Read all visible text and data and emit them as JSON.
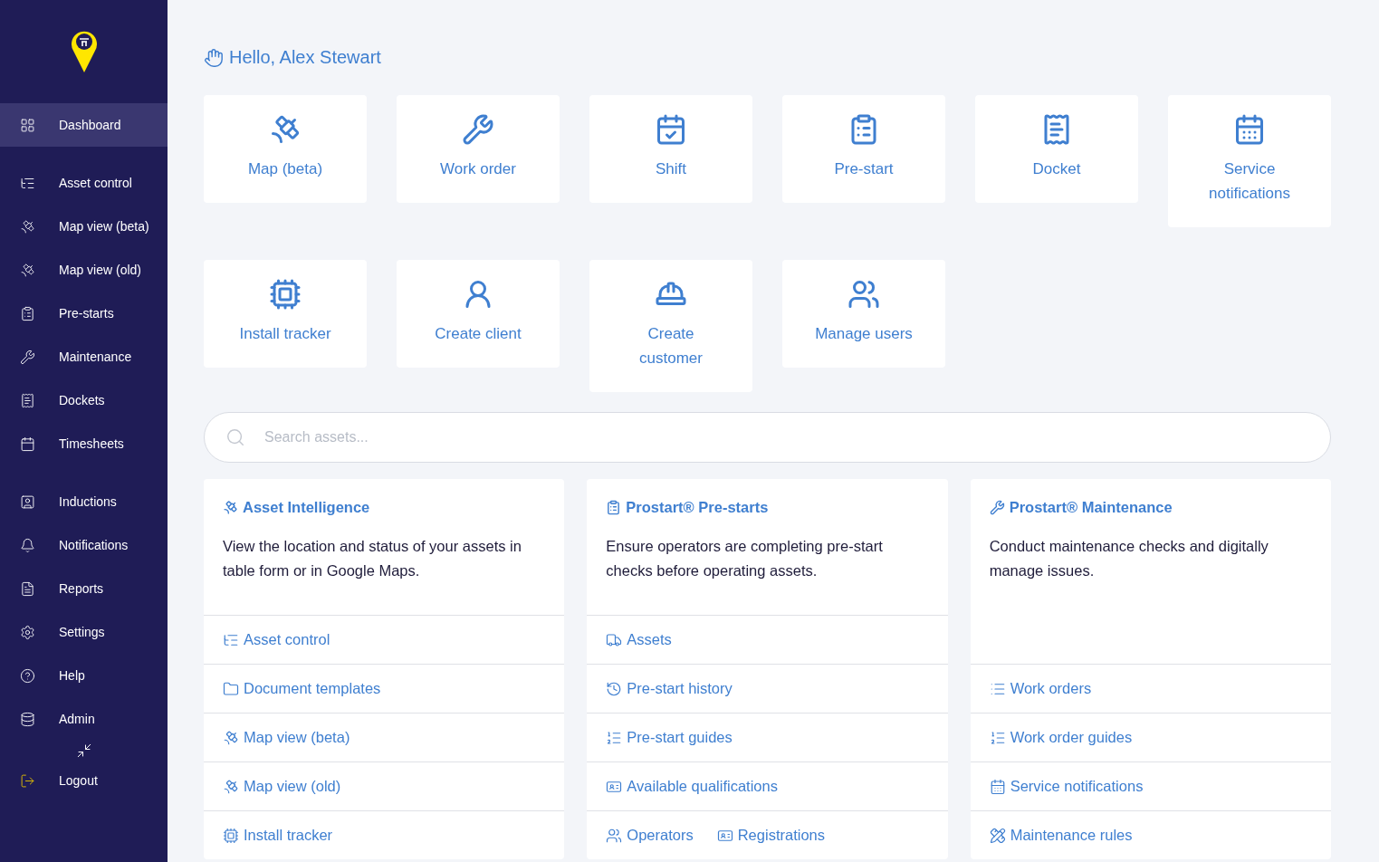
{
  "sidebar": {
    "sections": [
      [
        {
          "label": "Dashboard",
          "selected": true
        }
      ],
      [
        {
          "label": "Asset control",
          "selected": false
        },
        {
          "label": "Map view (beta)",
          "selected": false
        },
        {
          "label": "Map view (old)",
          "selected": false
        },
        {
          "label": "Pre-starts",
          "selected": false
        },
        {
          "label": "Maintenance",
          "selected": false
        },
        {
          "label": "Dockets",
          "selected": false
        },
        {
          "label": "Timesheets",
          "selected": false
        }
      ],
      [
        {
          "label": "Inductions",
          "selected": false
        },
        {
          "label": "Notifications",
          "selected": false
        },
        {
          "label": "Reports",
          "selected": false
        },
        {
          "label": "Settings",
          "selected": false
        },
        {
          "label": "Help",
          "selected": false
        },
        {
          "label": "Admin",
          "selected": false
        }
      ]
    ],
    "logout": "Logout"
  },
  "greeting": "Hello, Alex Stewart",
  "tiles": [
    [
      {
        "label": "Map (beta)"
      },
      {
        "label": "Work order"
      },
      {
        "label": "Shift"
      },
      {
        "label": "Pre-start"
      },
      {
        "label": "Docket"
      },
      {
        "label": "Service notifications"
      }
    ],
    [
      {
        "label": "Install tracker"
      },
      {
        "label": "Create client"
      },
      {
        "label": "Create customer"
      },
      {
        "label": "Manage users"
      }
    ]
  ],
  "search": {
    "placeholder": "Search assets..."
  },
  "cards": [
    {
      "title": "Asset Intelligence",
      "description": "View the location and status of your assets in table form or in Google Maps.",
      "rows": [
        [
          "Asset control"
        ],
        [
          "Document templates"
        ],
        [
          "Map view (beta)"
        ],
        [
          "Map view (old)"
        ],
        [
          "Install tracker"
        ]
      ]
    },
    {
      "title": "Prostart® Pre-starts",
      "description": "Ensure operators are completing pre-start checks before operating assets.",
      "rows": [
        [
          "Assets"
        ],
        [
          "Pre-start history"
        ],
        [
          "Pre-start guides"
        ],
        [
          "Available qualifications"
        ],
        [
          "Operators",
          "Registrations"
        ]
      ]
    },
    {
      "title": "Prostart® Maintenance",
      "description": "Conduct maintenance checks and digitally manage issues.",
      "rows": [
        [
          "Work orders"
        ],
        [
          "Work order guides"
        ],
        [
          "Service notifications"
        ],
        [
          "Maintenance rules"
        ]
      ]
    }
  ]
}
